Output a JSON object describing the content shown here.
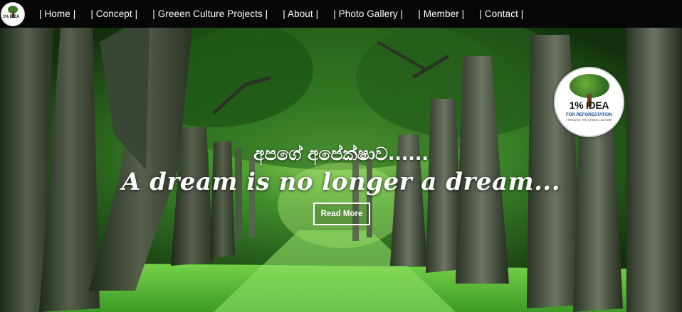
{
  "nav": {
    "logo": {
      "icon": "tree-logo-icon",
      "text": "1% IDEA"
    },
    "items": [
      {
        "label": "| Home |"
      },
      {
        "label": "| Concept |"
      },
      {
        "label": "| Greeen Culture Projects |"
      },
      {
        "label": "| About |"
      },
      {
        "label": "| Photo Gallery |"
      },
      {
        "label": "| Member |"
      },
      {
        "label": "| Contact |"
      }
    ]
  },
  "hero": {
    "background": "forest-avenue-image",
    "badge": {
      "icon": "tree-logo-icon",
      "title": "1% IDEA",
      "subtitle": "FOR REFORESTATION",
      "subtitle2": "THROUGH THE GREEN CULTURE"
    },
    "sinhala_heading": "අපගේ අපේක්ෂාව......",
    "tagline": "A dream is no longer a dream...",
    "cta_label": "Read More"
  },
  "colors": {
    "nav_bg": "#070707",
    "nav_text": "#ffffff",
    "foliage": "#2e7a23",
    "grass": "#5cbf3a"
  }
}
